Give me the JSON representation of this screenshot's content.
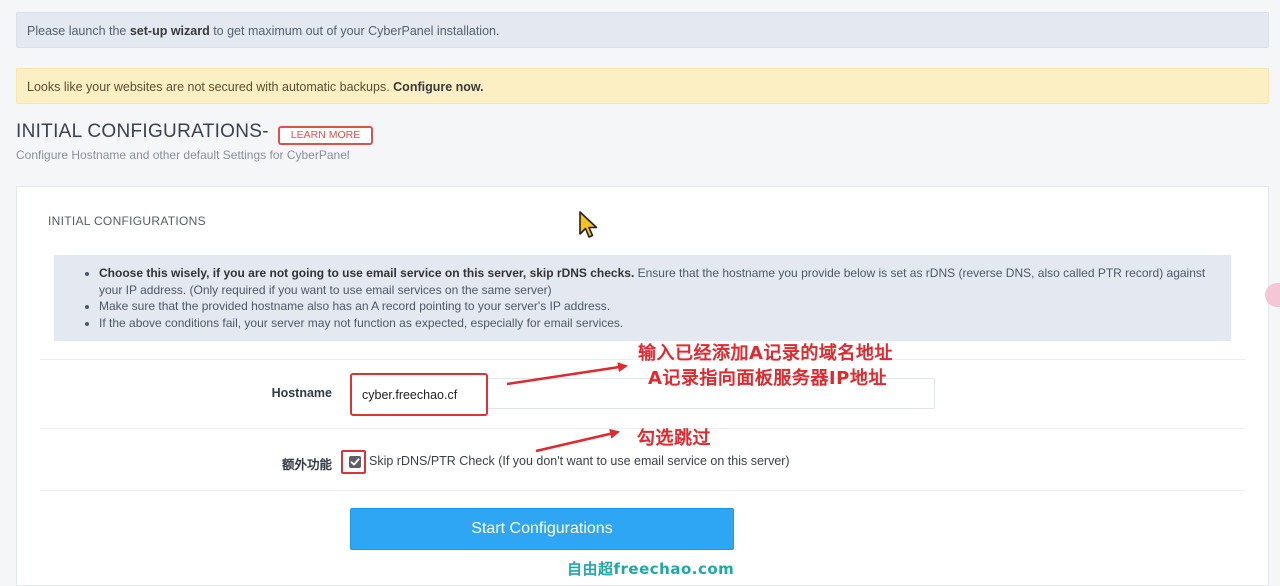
{
  "alerts": {
    "wizard": {
      "before": "Please launch the ",
      "link": "set-up wizard",
      "after": " to get maximum out of your CyberPanel installation."
    },
    "backup": {
      "before": "Looks like your websites are not secured with automatic backups. ",
      "link": "Configure now."
    }
  },
  "header": {
    "title": "INITIAL CONFIGURATIONS-",
    "learn_more": "LEARN MORE",
    "subtitle": "Configure Hostname and other default Settings for CyberPanel"
  },
  "panel": {
    "title": "INITIAL CONFIGURATIONS",
    "info": [
      {
        "bold": "Choose this wisely, if you are not going to use email service on this server, skip rDNS checks.",
        "text": " Ensure that the hostname you provide below is set as rDNS (reverse DNS, also called PTR record) against your IP address. (Only required if you want to use email services on the same server)"
      },
      {
        "bold": "",
        "text": "Make sure that the provided hostname also has an A record pointing to your server's IP address."
      },
      {
        "bold": "",
        "text": "If the above conditions fail, your server may not function as expected, especially for email services."
      }
    ],
    "hostname_label": "Hostname",
    "hostname_value": "cyber.freechao.cf",
    "extra_label": "额外功能",
    "skip_rdns_label": "Skip rDNS/PTR Check (If you don't want to use email service on this server)",
    "skip_rdns_checked": true,
    "start_button": "Start Configurations"
  },
  "annotations": {
    "note1": "输入已经添加A记录的域名地址",
    "note2": "A记录指向面板服务器IP地址",
    "note3": "勾选跳过",
    "color": "#e0292f"
  },
  "watermark": "自由超freechao.com",
  "colors": {
    "accent": "#2fa6f4",
    "danger": "#d9534f",
    "info_bg": "#e3e8f1",
    "warning_bg": "#fcefc4"
  }
}
